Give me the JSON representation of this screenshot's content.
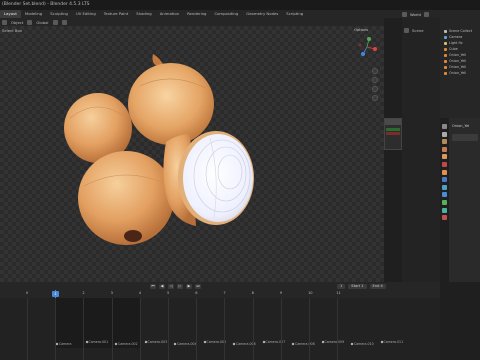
{
  "window": {
    "title": "(Blender Set.blend) - Blender 4.5.3 LTS"
  },
  "workspace_tabs": [
    "Layout",
    "Modeling",
    "Sculpting",
    "UV Editing",
    "Texture Paint",
    "Shading",
    "Animation",
    "Rendering",
    "Compositing",
    "Geometry Nodes",
    "Scripting"
  ],
  "scene_bar": {
    "world_label": "World"
  },
  "viewport": {
    "mode": "Object",
    "orientation": "Global",
    "select_box": "Select Box",
    "options_label": "Options"
  },
  "outliner": {
    "header": "Scene",
    "items": [
      {
        "label": "Scene Collect",
        "kind": "col"
      },
      {
        "label": "Camera",
        "kind": "cam"
      },
      {
        "label": "Light fix",
        "kind": "lgt"
      },
      {
        "label": "Cube",
        "kind": "mesh"
      },
      {
        "label": "Onion_Yell",
        "kind": "mesh"
      },
      {
        "label": "Onion_Yell",
        "kind": "mesh"
      },
      {
        "label": "Onion_Yell",
        "kind": "mesh"
      },
      {
        "label": "Onion_Yell",
        "kind": "mesh"
      }
    ]
  },
  "properties": {
    "object_name": "Onion_Yel"
  },
  "timeline": {
    "start_label": "Start",
    "start_value": "1",
    "end_label": "End",
    "end_value": "4",
    "current_frame": "1",
    "ruler_ticks": [
      "0",
      "1",
      "2",
      "3",
      "4",
      "5",
      "6",
      "7",
      "8",
      "9",
      "10",
      "11"
    ],
    "markers": [
      {
        "label": "Camera"
      },
      {
        "label": "Camera.001"
      },
      {
        "label": "Camera.002"
      },
      {
        "label": "Camera.003"
      },
      {
        "label": "Camera.004"
      },
      {
        "label": "Camera.005"
      },
      {
        "label": "Camera.006"
      },
      {
        "label": "Camera.007"
      },
      {
        "label": "Camera.008"
      },
      {
        "label": "Camera.009"
      },
      {
        "label": "Camera.010"
      },
      {
        "label": "Camera.011"
      }
    ]
  },
  "colors": {
    "accent_blue": "#4a8ad8",
    "onion_skin": "#e8a96a",
    "onion_inside": "#f4f4f0"
  }
}
